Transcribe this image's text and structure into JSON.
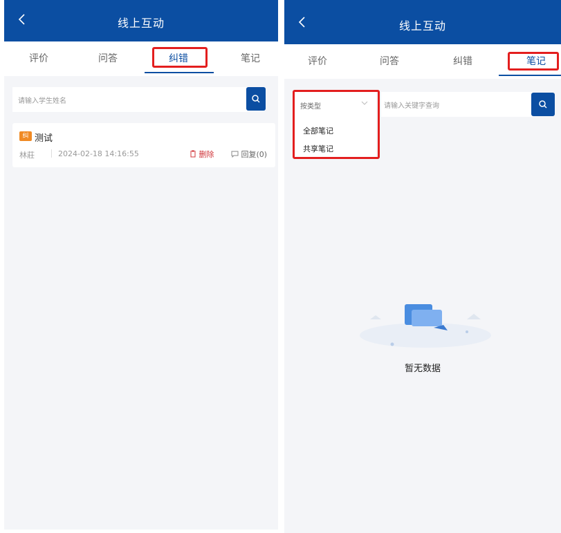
{
  "left": {
    "header": {
      "title": "线上互动"
    },
    "tabs": [
      {
        "label": "评价"
      },
      {
        "label": "问答"
      },
      {
        "label": "纠错"
      },
      {
        "label": "笔记"
      }
    ],
    "active_tab": "纠错",
    "search": {
      "placeholder": "请输入学生姓名"
    },
    "card": {
      "tag": "纠",
      "title": "测试",
      "author": "林莊",
      "datetime": "2024-02-18 14:16:55",
      "delete_label": "删除",
      "reply_label": "回复(0)"
    }
  },
  "right": {
    "header": {
      "title": "线上互动"
    },
    "tabs": [
      {
        "label": "评价"
      },
      {
        "label": "问答"
      },
      {
        "label": "纠错"
      },
      {
        "label": "笔记"
      }
    ],
    "active_tab": "笔记",
    "filter": {
      "selected": "按类型",
      "options": [
        "全部笔记",
        "共享笔记"
      ]
    },
    "search": {
      "placeholder": "请输入关键字查询"
    },
    "empty_text": "暂无数据"
  },
  "colors": {
    "brand": "#0b4ea2",
    "highlight": "#e31e1e",
    "delete": "#d0353a",
    "tag": "#f08a24"
  },
  "icons": [
    "back-icon",
    "search-icon",
    "trash-icon",
    "comment-icon",
    "chevron-down-icon",
    "empty-folder-icon"
  ]
}
